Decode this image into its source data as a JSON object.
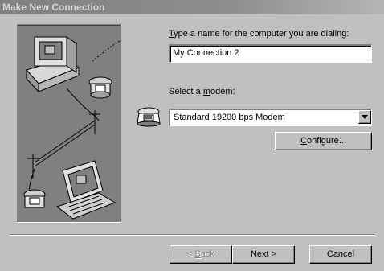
{
  "window": {
    "title": "Make New Connection"
  },
  "name_field": {
    "label_mnemonic": "T",
    "label_rest": "ype a name for the computer you are dialing:",
    "value": "My Connection 2"
  },
  "modem": {
    "label_pre": "Select a ",
    "label_mnemonic": "m",
    "label_post": "odem:",
    "selected": "Standard 19200 bps Modem",
    "icon": "telephone-icon"
  },
  "buttons": {
    "configure_mnemonic": "C",
    "configure_rest": "onfigure...",
    "back_pre": "< ",
    "back_mnemonic": "B",
    "back_rest": "ack",
    "next": "Next >",
    "cancel": "Cancel"
  },
  "illustration": {
    "icons": [
      "computer-icon",
      "telephone-icon",
      "telephone-pole-icon",
      "laptop-icon"
    ]
  },
  "colors": {
    "face": "#c0c0c0",
    "illustration_bg": "#808080",
    "titlebar": "#808080"
  }
}
